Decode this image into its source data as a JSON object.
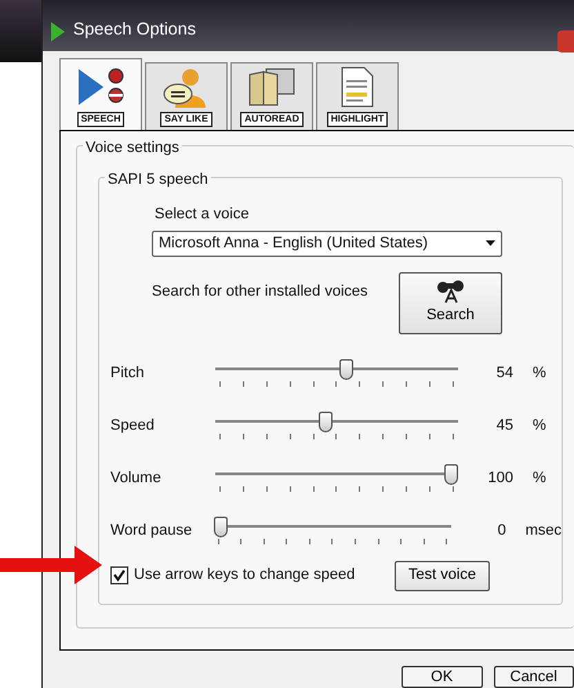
{
  "window": {
    "title": "Speech Options"
  },
  "tabs": [
    {
      "label": "SPEECH",
      "selected": true
    },
    {
      "label": "SAY LIKE",
      "selected": false
    },
    {
      "label": "AUTOREAD",
      "selected": false
    },
    {
      "label": "HIGHLIGHT",
      "selected": false
    }
  ],
  "voice_settings": {
    "title": "Voice settings",
    "sapi": {
      "title": "SAPI 5 speech",
      "voice_label": "Select a voice",
      "voice_value": "Microsoft Anna - English (United States)",
      "search_label": "Search for other installed voices",
      "search_button": "Search",
      "sliders": [
        {
          "label": "Pitch",
          "level": 0.54,
          "reading": "54",
          "unit": "%"
        },
        {
          "label": "Speed",
          "level": 0.45,
          "reading": "45",
          "unit": "%"
        },
        {
          "label": "Volume",
          "level": 1.0,
          "reading": "100",
          "unit": "%"
        },
        {
          "label": "Word pause",
          "level": 0.0,
          "reading": "0",
          "unit": "msec"
        }
      ],
      "arrow_keys": {
        "label": "Use arrow keys to change speed",
        "checked": true
      },
      "test_button": "Test voice"
    }
  },
  "buttons": [
    "OK",
    "Cancel"
  ]
}
